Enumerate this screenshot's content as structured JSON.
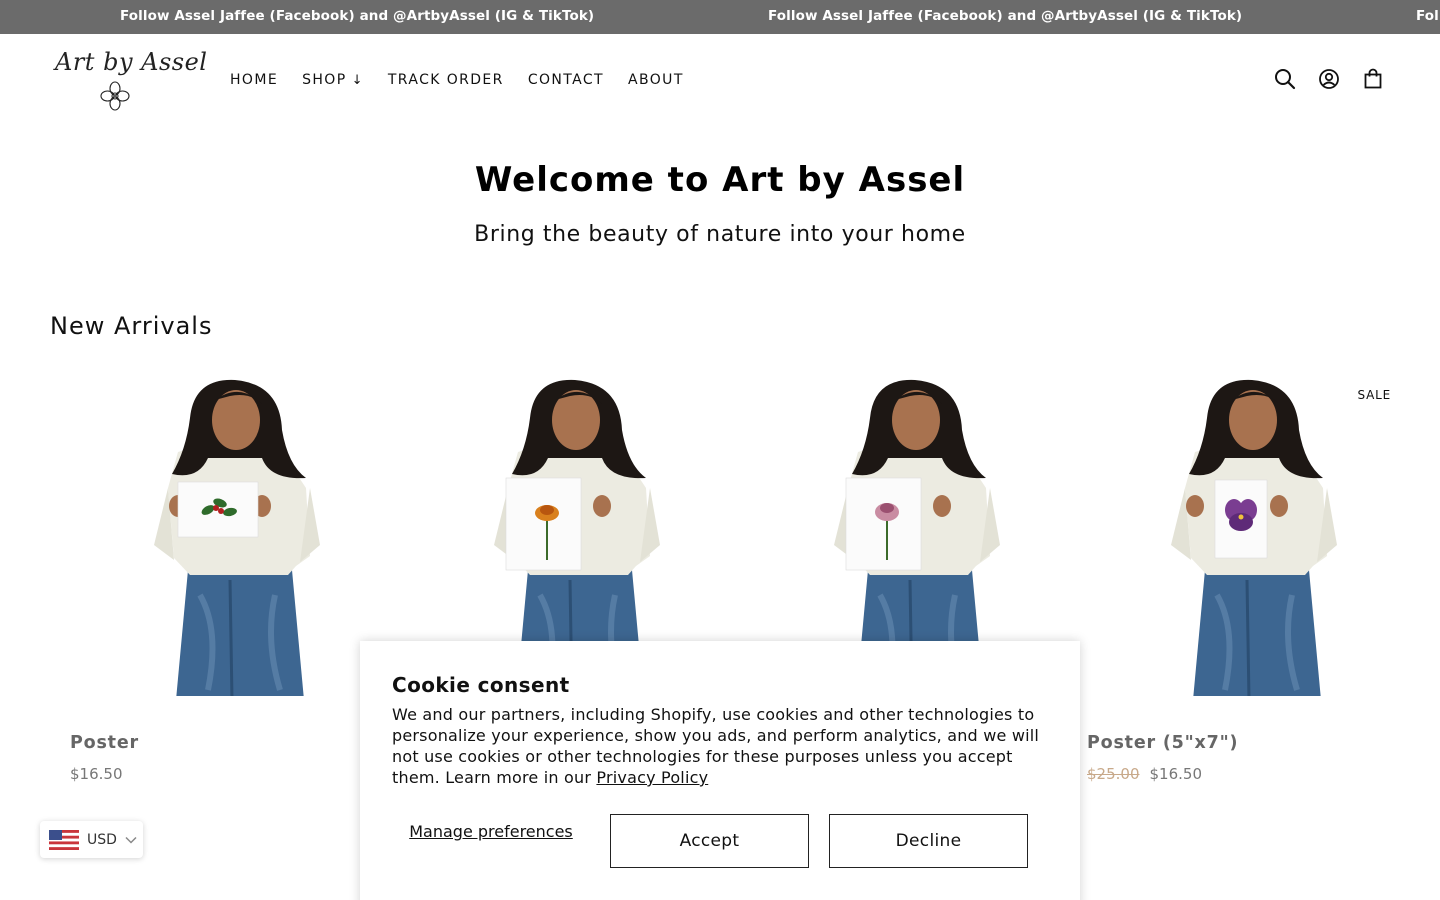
{
  "announcement": {
    "messages": [
      "Follow Assel Jaffee (Facebook) and @ArtbyAssel (IG & TikTok)",
      "Follow Assel Jaffee (Facebook) and @ArtbyAssel (IG & TikTok)",
      "Follow Assel Jaffee (Facebook) and @ArtbyAssel (IG & TikTok)"
    ]
  },
  "header": {
    "logo_text": "Art by Assel",
    "nav": [
      {
        "label": "HOME"
      },
      {
        "label": "SHOP",
        "chevron": "↓"
      },
      {
        "label": "TRACK ORDER"
      },
      {
        "label": "CONTACT"
      },
      {
        "label": "ABOUT"
      }
    ],
    "icons": [
      "search-icon",
      "account-icon",
      "cart-icon"
    ]
  },
  "hero": {
    "title": "Welcome to Art by Assel",
    "subtitle": "Bring the beauty of nature into your home"
  },
  "new_arrivals": {
    "title": "New Arrivals",
    "products": [
      {
        "name": "Poster",
        "price": "$16.50",
        "flower": "holly"
      },
      {
        "name": "",
        "price": "",
        "flower": "marigold"
      },
      {
        "name": "",
        "price": "",
        "flower": "carnation"
      },
      {
        "name": "Poster (5\"x7\")",
        "old_price": "$25.00",
        "price": "$16.50",
        "badge": "SALE",
        "flower": "pansy"
      }
    ]
  },
  "currency": {
    "code": "USD",
    "flag": "us-flag-icon"
  },
  "cookie": {
    "title": "Cookie consent",
    "body": "We and our partners, including Shopify, use cookies and other technologies to personalize your experience, show you ads, and perform analytics, and we will not use cookies or other technologies for these purposes unless you accept them. Learn more in our ",
    "link": "Privacy Policy",
    "manage": "Manage preferences",
    "accept": "Accept",
    "decline": "Decline"
  },
  "colors": {
    "announcement_bg": "#6b6b6b",
    "old_price": "#c8a98a",
    "jeans": "#3d6691",
    "sweater": "#ecebe1"
  }
}
